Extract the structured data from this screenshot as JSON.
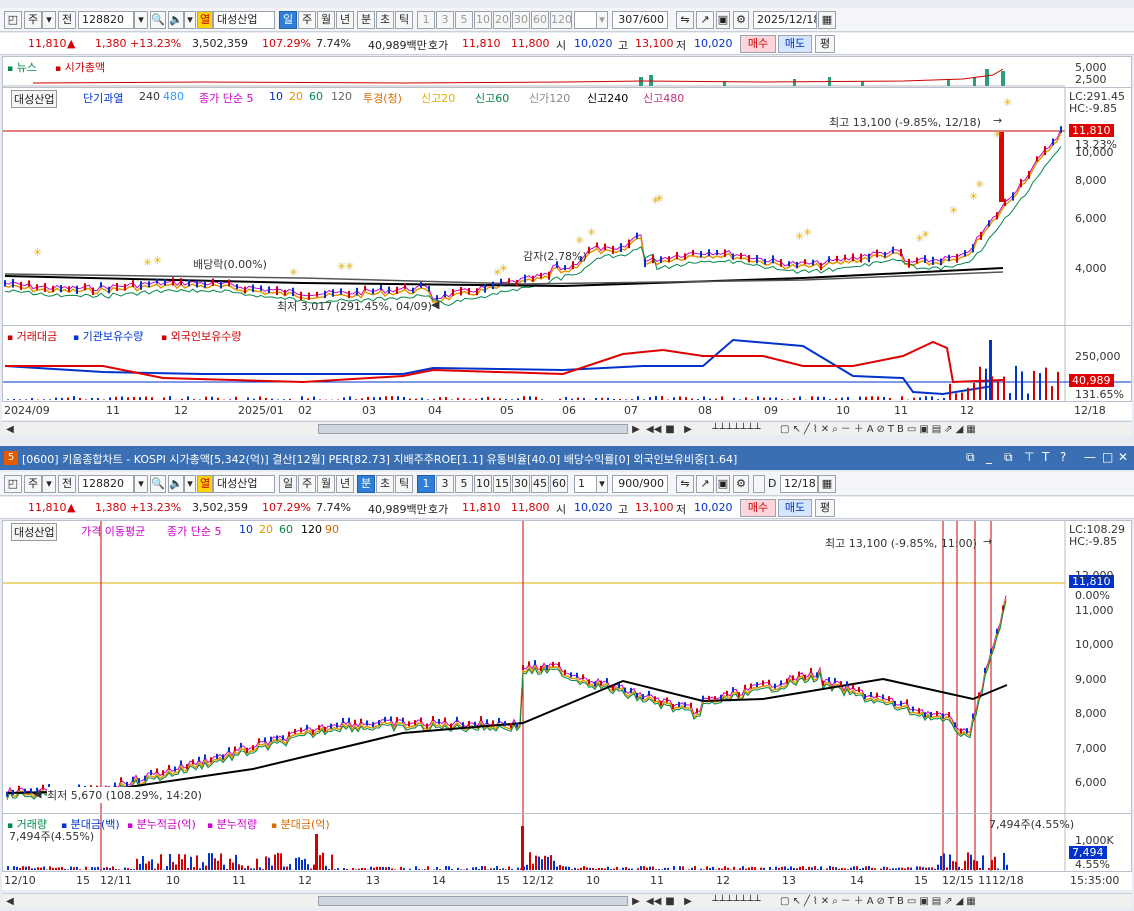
{
  "window": {
    "title": "[0600] 키움종합차트 - KOSPI 시가총액[5,342(억)] 결산[12월] PER[82.73] 지배주주ROE[1.1] 유통비율[40.0] 배당수익률[0] 외국인보유비중[1.64]",
    "badge": "5"
  },
  "top": {
    "toolbar": {
      "market": "주",
      "prev": "전",
      "code": "128820",
      "flag": "열",
      "name": "대성산업",
      "periods": [
        "일",
        "주",
        "월",
        "년",
        "분",
        "초",
        "틱"
      ],
      "selected_period": "일",
      "nums": [
        "1",
        "3",
        "5",
        "10",
        "20",
        "30",
        "60",
        "120"
      ],
      "count": "307/600",
      "date": "2025/12/18"
    },
    "quote": {
      "price": "11,810",
      "change": "1,380",
      "rate": "+13.23%",
      "volume": "3,502,359",
      "vol_ratio": "107.29%",
      "turnover": "7.74%",
      "amount": "40,989백만",
      "hoga_label": "호가",
      "ask": "11,810",
      "bid": "11,800",
      "open_label": "시",
      "open": "10,020",
      "high_label": "고",
      "high": "13,100",
      "low_label": "저",
      "low": "10,020",
      "buy": "매수",
      "sell": "매도",
      "eval": "평"
    },
    "news": {
      "news_label": "뉴스",
      "cap_label": "시가총액",
      "ticks": [
        "5,000",
        "2,500"
      ]
    },
    "price_chart": {
      "legend": {
        "name": "대성산업",
        "items": [
          "단기과열",
          "240",
          "480",
          "종가 단순 5",
          "10",
          "20",
          "60",
          "120",
          "투경(청)",
          "신고20",
          "신고60",
          "신가120",
          "신고240",
          "신고480"
        ]
      },
      "lc": "LC:291.45",
      "hc": "HC:-9.85",
      "max_label": "최고 13,100 (-9.85%, 12/18)",
      "min_label": "최저 3,017 (291.45%, 04/09)",
      "div_label": "배당락(0.00%)",
      "cap_label": "감자(2.78%)",
      "current": "11,810",
      "current_rate": "13.23%",
      "y_ticks": [
        "10,000",
        "8,000",
        "6,000",
        "4,000"
      ]
    },
    "volume_chart": {
      "legend": [
        "거래대금",
        "기관보유수량",
        "외국인보유수량"
      ],
      "y_ticks": [
        "250,000"
      ],
      "current": "40,989",
      "current_rate": "131.65%"
    },
    "x_axis": [
      "2024/09",
      "11",
      "12",
      "2025/01",
      "02",
      "03",
      "04",
      "05",
      "06",
      "07",
      "08",
      "09",
      "10",
      "11",
      "12"
    ],
    "x_end": "12/18"
  },
  "bottom": {
    "toolbar": {
      "market": "주",
      "prev": "전",
      "code": "128820",
      "flag": "열",
      "name": "대성산업",
      "periods": [
        "일",
        "주",
        "월",
        "년",
        "분",
        "초",
        "틱"
      ],
      "selected_period": "분",
      "nums": [
        "1",
        "3",
        "5",
        "10",
        "15",
        "30",
        "45",
        "60"
      ],
      "selected_num": "1",
      "interval": "1",
      "count": "900/900",
      "d_label": "D",
      "date": "12/18"
    },
    "quote": {
      "price": "11,810",
      "change": "1,380",
      "rate": "+13.23%",
      "volume": "3,502,359",
      "vol_ratio": "107.29%",
      "turnover": "7.74%",
      "amount": "40,989백만",
      "hoga_label": "호가",
      "ask": "11,810",
      "bid": "11,800",
      "open_label": "시",
      "open": "10,020",
      "high_label": "고",
      "high": "13,100",
      "low_label": "저",
      "low": "10,020",
      "buy": "매수",
      "sell": "매도",
      "eval": "평"
    },
    "price_chart": {
      "legend": {
        "name": "대성산업",
        "items": [
          "가격 이동평균",
          "종가 단순 5",
          "10",
          "20",
          "60",
          "120",
          "90"
        ]
      },
      "lc": "LC:108.29",
      "hc": "HC:-9.85",
      "max_label": "최고 13,100 (-9.85%, 11:00)",
      "min_label": "최저 5,670 (108.29%, 14:20)",
      "current": "11,810",
      "current_rate": "0.00%",
      "y_ticks": [
        "12,000",
        "11,000",
        "10,000",
        "9,000",
        "8,000",
        "7,000",
        "6,000"
      ]
    },
    "volume_chart": {
      "legend": [
        "거래량",
        "분대금(백)",
        "분누적금(억)",
        "분누적량",
        "분대금(억)"
      ],
      "left_value": "7,494주(4.55%)",
      "right_value": "7,494주(4.55%)",
      "y_ticks": [
        "1,000K"
      ],
      "current": "7,494",
      "current_rate": "4.55%"
    },
    "x_axis": [
      "12/10",
      "15",
      "12/11",
      "10",
      "11",
      "12",
      "13",
      "14",
      "15",
      "12/12",
      "10",
      "11",
      "12",
      "13",
      "14",
      "15",
      "12/15",
      "11",
      "12/18"
    ],
    "x_end": "15:35:00"
  },
  "colors": {
    "up": "#d40000",
    "down": "#0033cc",
    "ma5": "#cc00cc",
    "ma10": "#0033cc",
    "ma20": "#e09a00",
    "ma60": "#00884a",
    "ma120": "#333333",
    "ma240": "#000000",
    "titlebar": "#3b6fb3"
  },
  "icons": [
    "dropdown-icon",
    "search-icon",
    "sound-icon",
    "gear-icon",
    "save-icon",
    "grid-icon",
    "scroll-left-icon",
    "scroll-right-icon",
    "play-icon",
    "stop-icon",
    "zoom-in-icon",
    "zoom-out-icon",
    "minimize-icon",
    "maximize-icon",
    "close-icon",
    "help-icon"
  ]
}
